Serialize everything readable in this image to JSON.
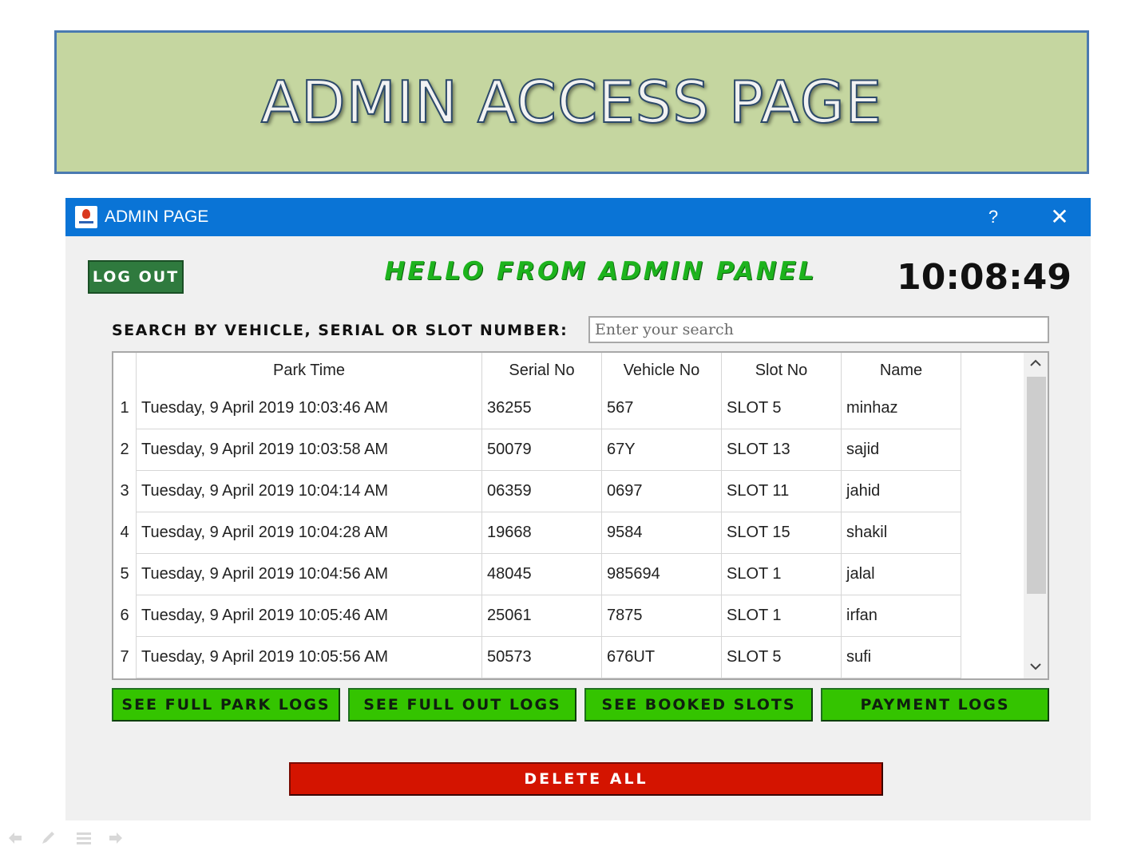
{
  "slide": {
    "banner_title": "ADMIN ACCESS PAGE"
  },
  "window": {
    "title": "ADMIN PAGE",
    "help_label": "?",
    "close_label": "✕"
  },
  "header": {
    "logout_label": "LOG OUT",
    "greeting": "HELLO FROM ADMIN PANEL",
    "clock": "10:08:49"
  },
  "search": {
    "label": "SEARCH BY VEHICLE, SERIAL OR SLOT NUMBER:",
    "placeholder": "Enter your search",
    "value": ""
  },
  "table": {
    "columns": [
      "Park Time",
      "Serial No",
      "Vehicle No",
      "Slot No",
      "Name"
    ],
    "rows": [
      {
        "num": "1",
        "park_time": "Tuesday, 9 April 2019 10:03:46 AM",
        "serial": "36255",
        "vehicle": "567",
        "slot": "SLOT 5",
        "name": "minhaz"
      },
      {
        "num": "2",
        "park_time": "Tuesday, 9 April 2019 10:03:58 AM",
        "serial": "50079",
        "vehicle": "67Y",
        "slot": "SLOT 13",
        "name": "sajid"
      },
      {
        "num": "3",
        "park_time": "Tuesday, 9 April 2019 10:04:14 AM",
        "serial": "06359",
        "vehicle": "0697",
        "slot": "SLOT 11",
        "name": "jahid"
      },
      {
        "num": "4",
        "park_time": "Tuesday, 9 April 2019 10:04:28 AM",
        "serial": "19668",
        "vehicle": "9584",
        "slot": "SLOT 15",
        "name": "shakil"
      },
      {
        "num": "5",
        "park_time": "Tuesday, 9 April 2019 10:04:56 AM",
        "serial": "48045",
        "vehicle": "985694",
        "slot": "SLOT 1",
        "name": "jalal"
      },
      {
        "num": "6",
        "park_time": "Tuesday, 9 April 2019 10:05:46 AM",
        "serial": "25061",
        "vehicle": "7875",
        "slot": "SLOT 1",
        "name": "irfan"
      },
      {
        "num": "7",
        "park_time": "Tuesday, 9 April 2019 10:05:56 AM",
        "serial": "50573",
        "vehicle": "676UT",
        "slot": "SLOT 5",
        "name": "sufi"
      }
    ]
  },
  "actions": {
    "full_park_logs": "SEE FULL PARK LOGS",
    "full_out_logs": "SEE FULL OUT LOGS",
    "booked_slots": "SEE BOOKED SLOTS",
    "payment_logs": "PAYMENT LOGS",
    "delete_all": "DELETE ALL"
  },
  "icons": {
    "app": "app-logo-icon",
    "scroll_up": "chevron-up-icon",
    "scroll_down": "chevron-down-icon",
    "nav_prev": "arrow-left-icon",
    "nav_pen": "pen-icon",
    "nav_menu": "menu-icon",
    "nav_next": "arrow-right-icon"
  },
  "colors": {
    "banner_bg": "#c5d6a0",
    "titlebar": "#0a74d6",
    "greeting": "#1db31d",
    "action_green": "#34c400",
    "logout_green": "#2f7a3e",
    "delete_red": "#d41400"
  }
}
